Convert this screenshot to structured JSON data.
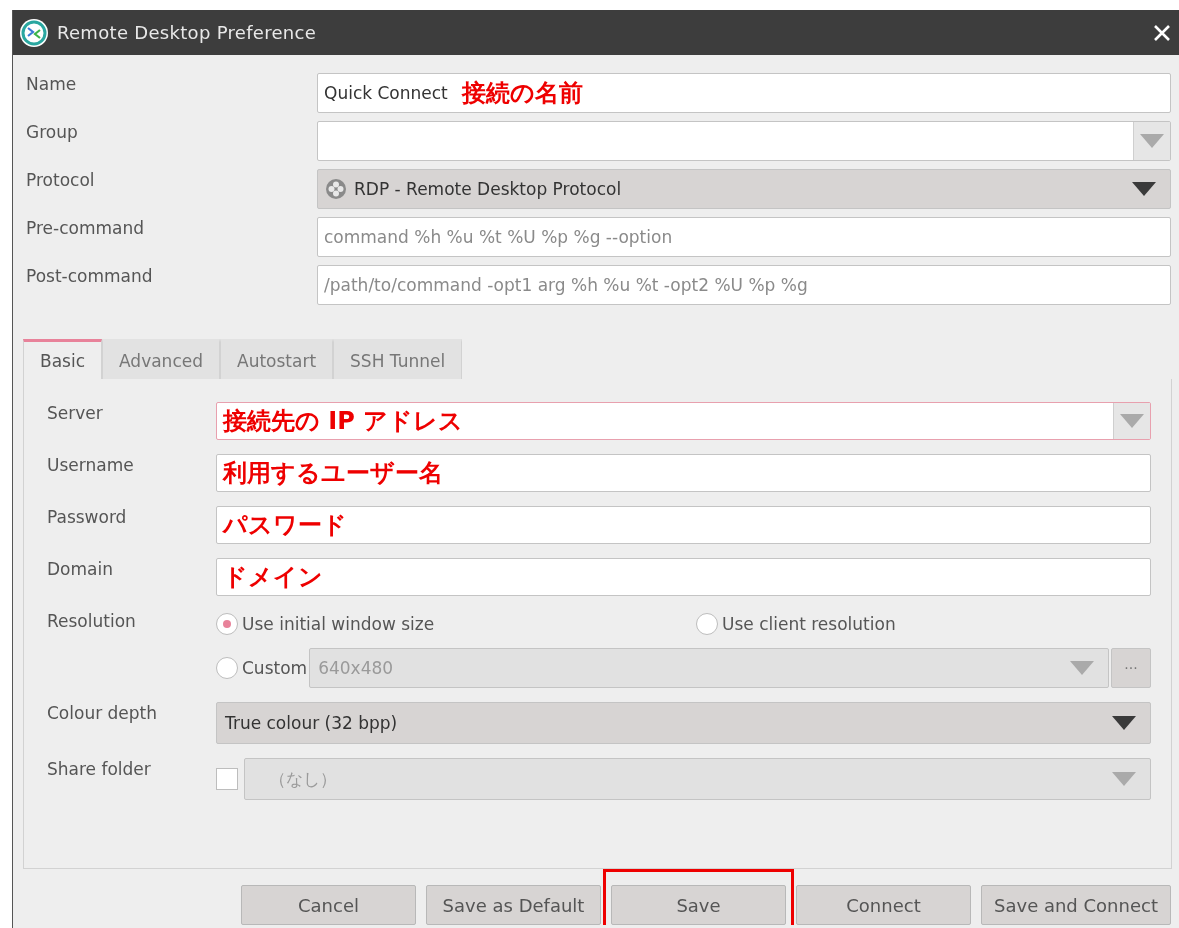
{
  "window": {
    "title": "Remote Desktop Preference"
  },
  "top_fields": [
    {
      "label": "Name",
      "kind": "entry",
      "value": "Quick Connect",
      "annotation": "接続の名前"
    },
    {
      "label": "Group",
      "kind": "combo"
    },
    {
      "label": "Protocol",
      "kind": "select",
      "value": "RDP - Remote Desktop Protocol",
      "icon": true
    },
    {
      "label": "Pre-command",
      "kind": "entry",
      "placeholder": "command %h %u %t %U %p %g --option"
    },
    {
      "label": "Post-command",
      "kind": "entry",
      "placeholder": "/path/to/command -opt1 arg %h %u %t -opt2 %U %p %g"
    }
  ],
  "tabs": [
    {
      "label": "Basic",
      "selected": true
    },
    {
      "label": "Advanced",
      "selected": false
    },
    {
      "label": "Autostart",
      "selected": false
    },
    {
      "label": "SSH Tunnel",
      "selected": false
    }
  ],
  "basic": {
    "fields": [
      {
        "label": "Server",
        "kind": "combo",
        "focused": true,
        "annotation": "接続先の IP アドレス"
      },
      {
        "label": "Username",
        "kind": "entry",
        "annotation": "利用するユーザー名"
      },
      {
        "label": "Password",
        "kind": "entry",
        "annotation": "パスワード"
      },
      {
        "label": "Domain",
        "kind": "entry",
        "annotation": "ドメイン"
      }
    ],
    "resolution": {
      "label": "Resolution",
      "options": [
        {
          "label": "Use initial window size",
          "selected": true
        },
        {
          "label": "Use client resolution",
          "selected": false
        },
        {
          "label": "Custom",
          "selected": false
        }
      ],
      "custom_value": "640x480",
      "custom_disabled": true,
      "more_button": "···"
    },
    "colour_depth": {
      "label": "Colour depth",
      "value": "True colour (32 bpp)",
      "disabled": false
    },
    "share_folder": {
      "label": "Share folder",
      "checked": false,
      "value": "（なし）",
      "disabled": true
    }
  },
  "buttons": [
    {
      "label": "Cancel",
      "highlighted": false
    },
    {
      "label": "Save as Default",
      "highlighted": false
    },
    {
      "label": "Save",
      "highlighted": true
    },
    {
      "label": "Connect",
      "highlighted": false
    },
    {
      "label": "Save and Connect",
      "highlighted": false
    }
  ]
}
